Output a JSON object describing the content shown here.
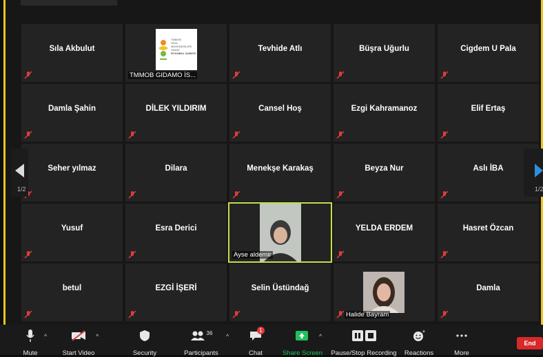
{
  "gallery": {
    "page_indicator": "1/2",
    "tiles": [
      {
        "name": "Sıla Akbulut"
      },
      {
        "name": "TMMOB GIDAMO İS..."
      },
      {
        "name": "Tevhide Atlı"
      },
      {
        "name": "Büşra Uğurlu"
      },
      {
        "name": "Cigdem U Pala"
      },
      {
        "name": "Damla Şahin"
      },
      {
        "name": "DİLEK YILDIRIM"
      },
      {
        "name": "Cansel Hoş"
      },
      {
        "name": "Ezgi Kahramanoz"
      },
      {
        "name": "Elif Ertaş"
      },
      {
        "name": "Seher yılmaz"
      },
      {
        "name": "Dilara"
      },
      {
        "name": "Menekşe Karakaş"
      },
      {
        "name": "Beyza Nur"
      },
      {
        "name": "Aslı İBA"
      },
      {
        "name": "Yusuf"
      },
      {
        "name": "Esra Derici"
      },
      {
        "name": "Ayse aldemir"
      },
      {
        "name": "YELDA ERDEM"
      },
      {
        "name": "Hasret Özcan"
      },
      {
        "name": "betul"
      },
      {
        "name": "EZGİ İŞERİ"
      },
      {
        "name": "Selin Üstündağ"
      },
      {
        "name": "Halide Bayram"
      },
      {
        "name": "Damla"
      }
    ]
  },
  "logo_text": [
    "TMMOB",
    "GIDA",
    "MÜHENDİSLERİ",
    "ODASI",
    "İSTANBUL ŞUBESİ"
  ],
  "toolbar": {
    "mute": "Mute",
    "start_video": "Start Video",
    "security": "Security",
    "participants": "Participants",
    "participants_count": "36",
    "chat": "Chat",
    "chat_badge": "1",
    "share_screen": "Share Screen",
    "recording": "Pause/Stop Recording",
    "reactions": "Reactions",
    "more": "More",
    "end": "End"
  },
  "colors": {
    "active_speaker_border": "#c6e04a",
    "frame_border": "#f0c420",
    "muted_icon": "#e03c3c",
    "share_green": "#20c05c",
    "end_red": "#d62a2a"
  }
}
